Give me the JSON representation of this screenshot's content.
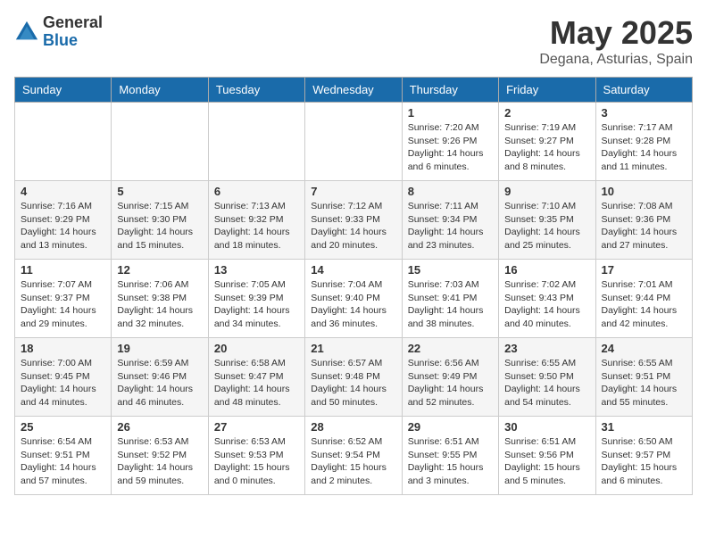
{
  "header": {
    "logo_general": "General",
    "logo_blue": "Blue",
    "title": "May 2025",
    "subtitle": "Degana, Asturias, Spain"
  },
  "calendar": {
    "days": [
      "Sunday",
      "Monday",
      "Tuesday",
      "Wednesday",
      "Thursday",
      "Friday",
      "Saturday"
    ],
    "rows": [
      [
        {
          "date": "",
          "info": ""
        },
        {
          "date": "",
          "info": ""
        },
        {
          "date": "",
          "info": ""
        },
        {
          "date": "",
          "info": ""
        },
        {
          "date": "1",
          "info": "Sunrise: 7:20 AM\nSunset: 9:26 PM\nDaylight: 14 hours\nand 6 minutes."
        },
        {
          "date": "2",
          "info": "Sunrise: 7:19 AM\nSunset: 9:27 PM\nDaylight: 14 hours\nand 8 minutes."
        },
        {
          "date": "3",
          "info": "Sunrise: 7:17 AM\nSunset: 9:28 PM\nDaylight: 14 hours\nand 11 minutes."
        }
      ],
      [
        {
          "date": "4",
          "info": "Sunrise: 7:16 AM\nSunset: 9:29 PM\nDaylight: 14 hours\nand 13 minutes."
        },
        {
          "date": "5",
          "info": "Sunrise: 7:15 AM\nSunset: 9:30 PM\nDaylight: 14 hours\nand 15 minutes."
        },
        {
          "date": "6",
          "info": "Sunrise: 7:13 AM\nSunset: 9:32 PM\nDaylight: 14 hours\nand 18 minutes."
        },
        {
          "date": "7",
          "info": "Sunrise: 7:12 AM\nSunset: 9:33 PM\nDaylight: 14 hours\nand 20 minutes."
        },
        {
          "date": "8",
          "info": "Sunrise: 7:11 AM\nSunset: 9:34 PM\nDaylight: 14 hours\nand 23 minutes."
        },
        {
          "date": "9",
          "info": "Sunrise: 7:10 AM\nSunset: 9:35 PM\nDaylight: 14 hours\nand 25 minutes."
        },
        {
          "date": "10",
          "info": "Sunrise: 7:08 AM\nSunset: 9:36 PM\nDaylight: 14 hours\nand 27 minutes."
        }
      ],
      [
        {
          "date": "11",
          "info": "Sunrise: 7:07 AM\nSunset: 9:37 PM\nDaylight: 14 hours\nand 29 minutes."
        },
        {
          "date": "12",
          "info": "Sunrise: 7:06 AM\nSunset: 9:38 PM\nDaylight: 14 hours\nand 32 minutes."
        },
        {
          "date": "13",
          "info": "Sunrise: 7:05 AM\nSunset: 9:39 PM\nDaylight: 14 hours\nand 34 minutes."
        },
        {
          "date": "14",
          "info": "Sunrise: 7:04 AM\nSunset: 9:40 PM\nDaylight: 14 hours\nand 36 minutes."
        },
        {
          "date": "15",
          "info": "Sunrise: 7:03 AM\nSunset: 9:41 PM\nDaylight: 14 hours\nand 38 minutes."
        },
        {
          "date": "16",
          "info": "Sunrise: 7:02 AM\nSunset: 9:43 PM\nDaylight: 14 hours\nand 40 minutes."
        },
        {
          "date": "17",
          "info": "Sunrise: 7:01 AM\nSunset: 9:44 PM\nDaylight: 14 hours\nand 42 minutes."
        }
      ],
      [
        {
          "date": "18",
          "info": "Sunrise: 7:00 AM\nSunset: 9:45 PM\nDaylight: 14 hours\nand 44 minutes."
        },
        {
          "date": "19",
          "info": "Sunrise: 6:59 AM\nSunset: 9:46 PM\nDaylight: 14 hours\nand 46 minutes."
        },
        {
          "date": "20",
          "info": "Sunrise: 6:58 AM\nSunset: 9:47 PM\nDaylight: 14 hours\nand 48 minutes."
        },
        {
          "date": "21",
          "info": "Sunrise: 6:57 AM\nSunset: 9:48 PM\nDaylight: 14 hours\nand 50 minutes."
        },
        {
          "date": "22",
          "info": "Sunrise: 6:56 AM\nSunset: 9:49 PM\nDaylight: 14 hours\nand 52 minutes."
        },
        {
          "date": "23",
          "info": "Sunrise: 6:55 AM\nSunset: 9:50 PM\nDaylight: 14 hours\nand 54 minutes."
        },
        {
          "date": "24",
          "info": "Sunrise: 6:55 AM\nSunset: 9:51 PM\nDaylight: 14 hours\nand 55 minutes."
        }
      ],
      [
        {
          "date": "25",
          "info": "Sunrise: 6:54 AM\nSunset: 9:51 PM\nDaylight: 14 hours\nand 57 minutes."
        },
        {
          "date": "26",
          "info": "Sunrise: 6:53 AM\nSunset: 9:52 PM\nDaylight: 14 hours\nand 59 minutes."
        },
        {
          "date": "27",
          "info": "Sunrise: 6:53 AM\nSunset: 9:53 PM\nDaylight: 15 hours\nand 0 minutes."
        },
        {
          "date": "28",
          "info": "Sunrise: 6:52 AM\nSunset: 9:54 PM\nDaylight: 15 hours\nand 2 minutes."
        },
        {
          "date": "29",
          "info": "Sunrise: 6:51 AM\nSunset: 9:55 PM\nDaylight: 15 hours\nand 3 minutes."
        },
        {
          "date": "30",
          "info": "Sunrise: 6:51 AM\nSunset: 9:56 PM\nDaylight: 15 hours\nand 5 minutes."
        },
        {
          "date": "31",
          "info": "Sunrise: 6:50 AM\nSunset: 9:57 PM\nDaylight: 15 hours\nand 6 minutes."
        }
      ]
    ]
  }
}
